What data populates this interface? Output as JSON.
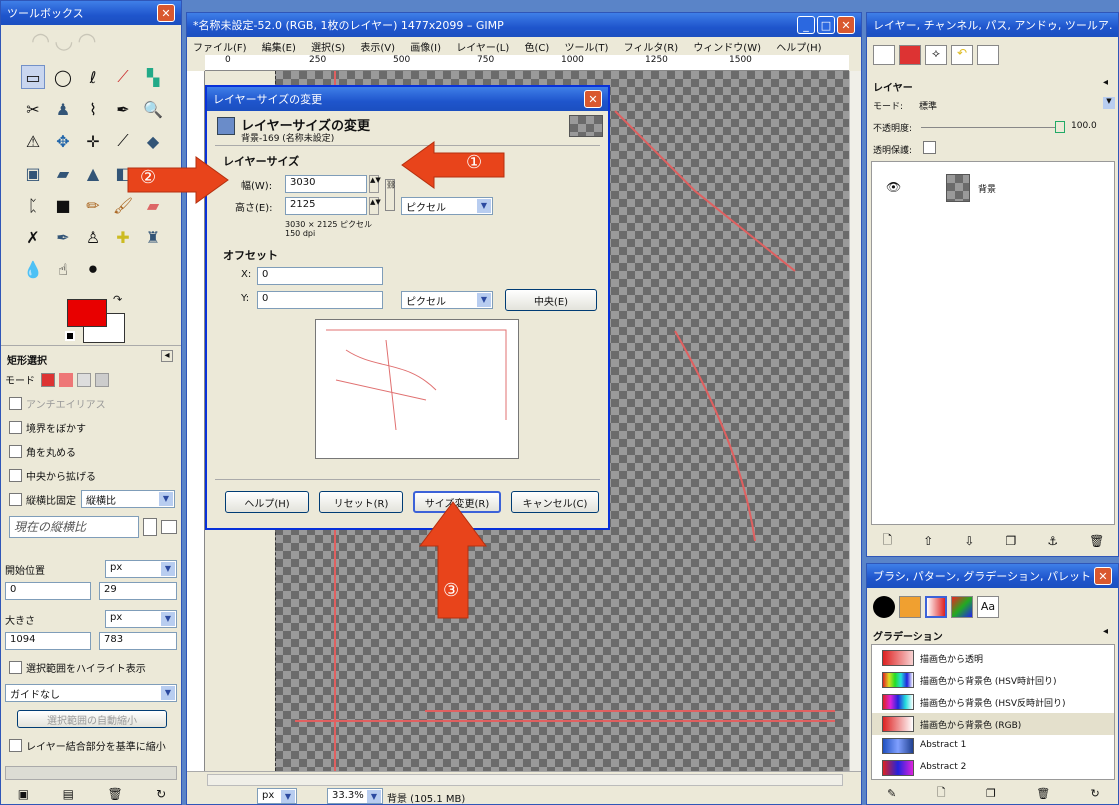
{
  "colors": {
    "accent": "#2f56b8",
    "callout": "#e8441b",
    "canvas_line": "#e06060",
    "fg": "#e80000",
    "bg": "#ffffff"
  },
  "toolbox": {
    "title": "ツールボックス",
    "options_title": "矩形選択",
    "mode_label": "モード",
    "antialias": "アンチエイリアス",
    "feather": "境界をぼかす",
    "rounded": "角を丸める",
    "expand_center": "中央から拡げる",
    "fixed_label": "縦横比固定",
    "fixed_combo": "縦横比",
    "aspect_placeholder": "現在の縦横比",
    "position_label": "開始位置",
    "position_unit": "px",
    "position_x": "0",
    "position_y": "29",
    "size_label": "大きさ",
    "size_unit": "px",
    "size_w": "1094",
    "size_h": "783",
    "highlight": "選択範囲をハイライト表示",
    "guides": "ガイドなし",
    "auto_shrink": "選択範囲の自動縮小",
    "merged": "レイヤー結合部分を基準に縮小"
  },
  "image_window": {
    "title": "*名称未設定-52.0 (RGB, 1枚のレイヤー) 1477x2099 – GIMP",
    "menu": [
      "ファイル(F)",
      "編集(E)",
      "選択(S)",
      "表示(V)",
      "画像(I)",
      "レイヤー(L)",
      "色(C)",
      "ツール(T)",
      "フィルタ(R)",
      "ウィンドウ(W)",
      "ヘルプ(H)"
    ],
    "ruler": [
      "0",
      "250",
      "500",
      "750",
      "1000",
      "1250",
      "1500"
    ],
    "status_unit": "px",
    "zoom": "33.3%",
    "status_text": "背景 (105.1 MB)"
  },
  "dialog": {
    "title": "レイヤーサイズの変更",
    "heading": "レイヤーサイズの変更",
    "subheading": "背景-169 (名称未設定)",
    "size_section": "レイヤーサイズ",
    "width_label": "幅(W):",
    "width_value": "3030",
    "height_label": "高さ(E):",
    "height_value": "2125",
    "unit": "ピクセル",
    "size_info": "3030 × 2125 ピクセル",
    "dpi": "150 dpi",
    "offset_section": "オフセット",
    "x_label": "X:",
    "x_value": "0",
    "y_label": "Y:",
    "y_value": "0",
    "offset_unit": "ピクセル",
    "center": "中央(E)",
    "help": "ヘルプ(H)",
    "reset": "リセット(R)",
    "resize": "サイズ変更(R)",
    "cancel": "キャンセル(C)"
  },
  "callouts": [
    "①",
    "②",
    "③"
  ],
  "layers_panel": {
    "title": "レイヤー, チャンネル, パス, アンドゥ, ツールア…",
    "section": "レイヤー",
    "mode_label": "モード:",
    "mode_value": "標準",
    "opacity_label": "不透明度:",
    "opacity_value": "100.0",
    "lock_label": "透明保護:",
    "layer_name": "背景"
  },
  "brushes_panel": {
    "title": "ブラシ, パターン, グラデーション, パレット, フ…",
    "section": "グラデーション",
    "items": [
      "描画色から透明",
      "描画色から背景色 (HSV時計回り)",
      "描画色から背景色 (HSV反時計回り)",
      "描画色から背景色 (RGB)",
      "Abstract 1",
      "Abstract 2"
    ]
  }
}
